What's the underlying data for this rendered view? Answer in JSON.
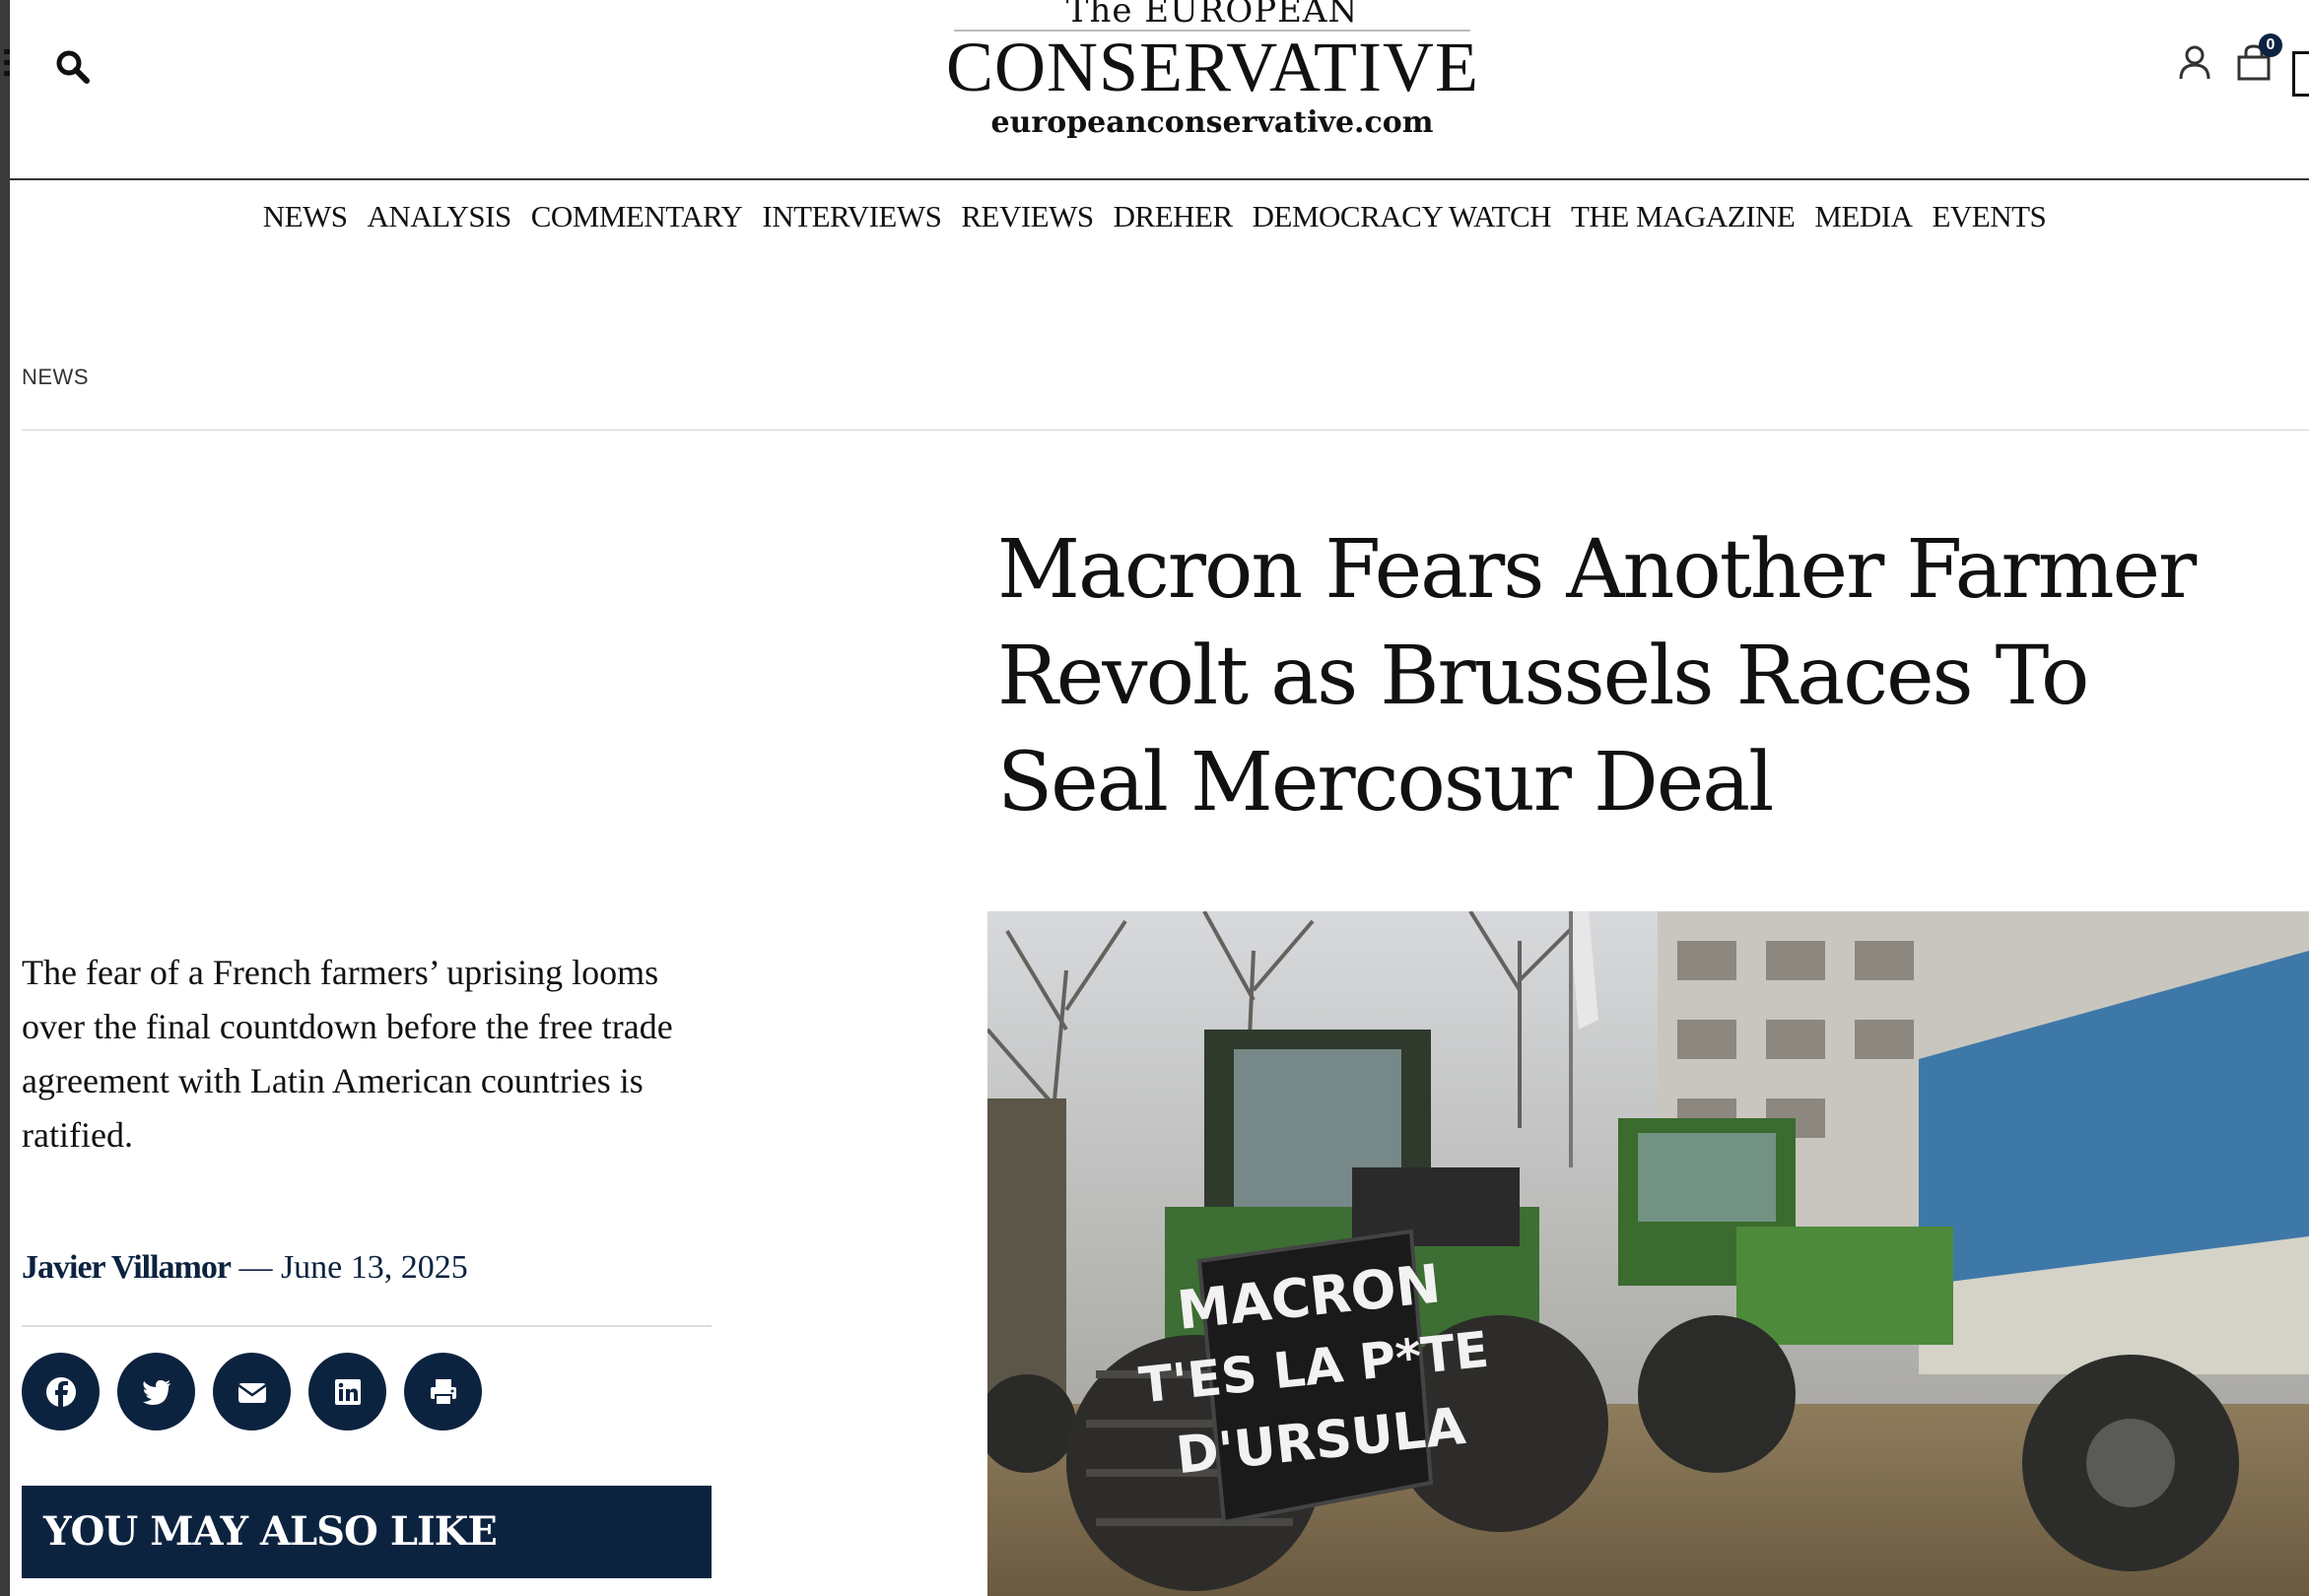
{
  "header": {
    "logo_line1": "The EUROPEAN",
    "logo_line2": "CONSERVATIVE",
    "logo_line3": "europeanconservative.com",
    "cart_count": "0"
  },
  "nav": {
    "items": [
      "NEWS",
      "ANALYSIS",
      "COMMENTARY",
      "INTERVIEWS",
      "REVIEWS",
      "DREHER",
      "DEMOCRACY WATCH",
      "THE MAGAZINE",
      "MEDIA",
      "EVENTS"
    ]
  },
  "article": {
    "category": "NEWS",
    "title": "Macron Fears Another Farmer Revolt as Brussels Races To Seal Mercosur Deal",
    "summary": "The fear of a French farmers’ uprising looms over the final countdown before the free trade agreement with Latin American countries is ratified.",
    "author": "Javier Villamor",
    "date_separator": " — ",
    "date": "June 13, 2025",
    "share_icons": [
      "facebook-icon",
      "twitter-icon",
      "email-icon",
      "linkedin-icon",
      "print-icon"
    ],
    "photo_sign_lines": [
      "MACRON",
      "T'ES LA P*TE",
      "D'URSULA"
    ]
  },
  "sidebar": {
    "also_like_label": "YOU MAY ALSO LIKE"
  },
  "colors": {
    "navy": "#0c2340",
    "text": "#111111"
  }
}
